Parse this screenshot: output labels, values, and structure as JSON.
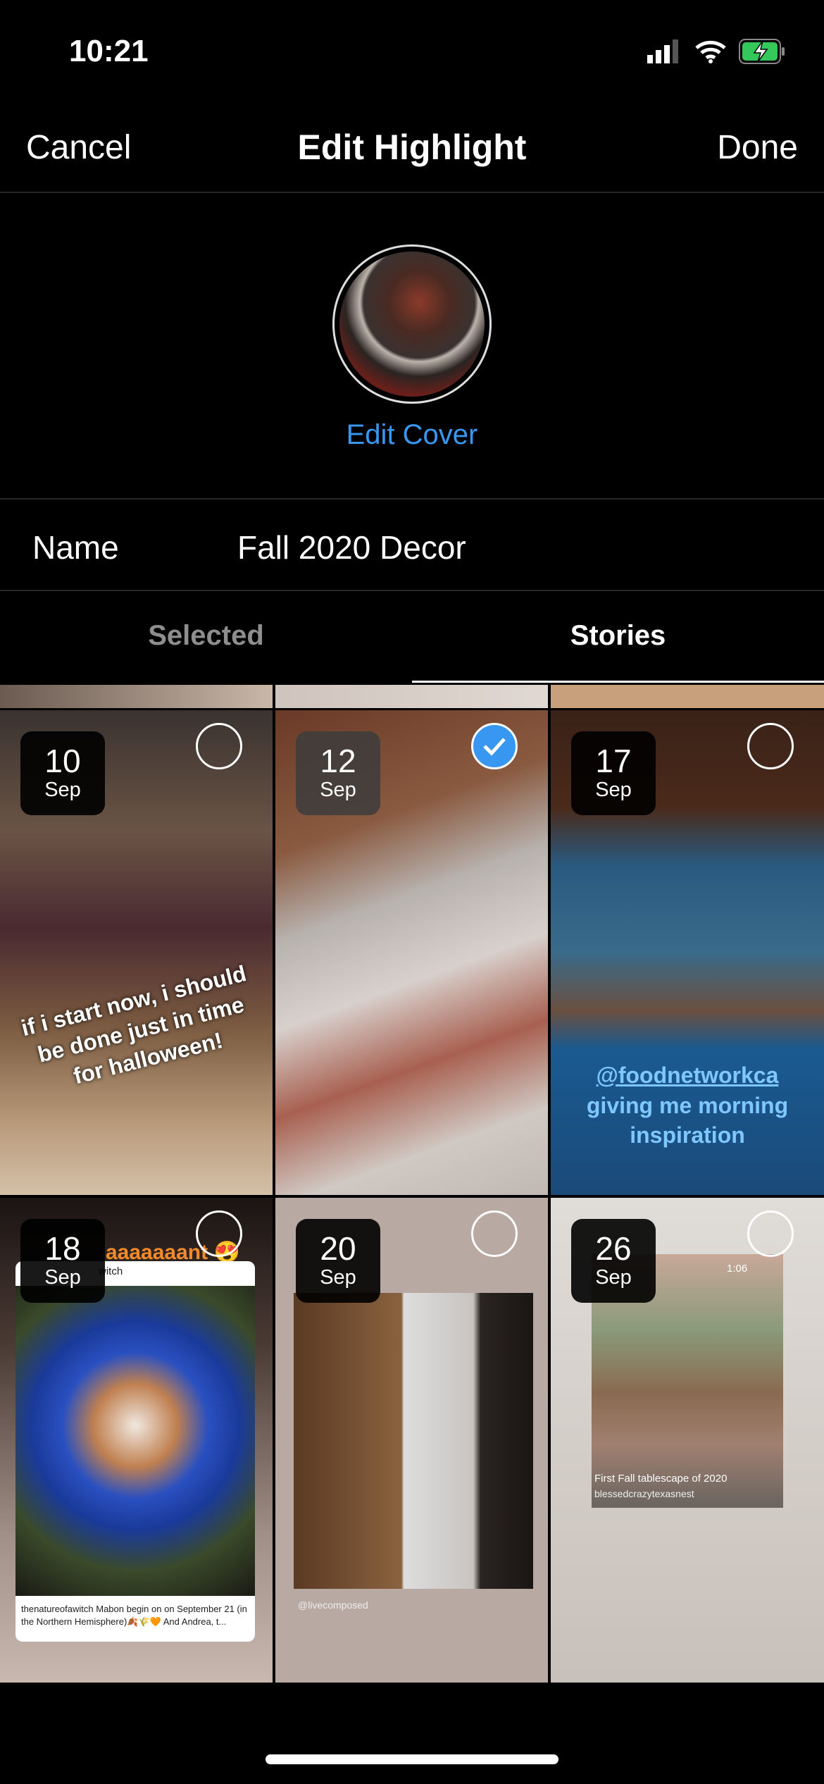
{
  "status_bar": {
    "time": "10:21",
    "icons": [
      "cellular-signal-icon",
      "wifi-icon",
      "battery-charging-icon"
    ],
    "battery_color": "#34c759"
  },
  "nav": {
    "cancel": "Cancel",
    "title": "Edit Highlight",
    "done": "Done"
  },
  "cover": {
    "edit_label": "Edit Cover",
    "link_color": "#3897f0"
  },
  "name_field": {
    "label": "Name",
    "value": "Fall 2020 Decor"
  },
  "tabs": [
    {
      "label": "Selected",
      "active": false
    },
    {
      "label": "Stories",
      "active": true
    }
  ],
  "stories": [
    {
      "day": "10",
      "month": "Sep",
      "selected": false,
      "caption": "if i start now, i should be done just in time for halloween!"
    },
    {
      "day": "12",
      "month": "Sep",
      "selected": true
    },
    {
      "day": "17",
      "month": "Sep",
      "selected": false,
      "caption_mention": "@foodnetworkca",
      "caption": "giving me morning inspiration"
    },
    {
      "day": "18",
      "month": "Sep",
      "selected": false,
      "caption": "aaaaaaant 😍",
      "post_user_fragment": "witch",
      "post_text": "thenatureofawitch Mabon begin on on September 21 (in the Northern Hemisphere)🍂🌾🧡 And Andrea, t..."
    },
    {
      "day": "20",
      "month": "Sep",
      "selected": false,
      "credit": "@livecomposed"
    },
    {
      "day": "26",
      "month": "Sep",
      "selected": false,
      "duration": "1:06",
      "caption": "First Fall tablescape of 2020",
      "credit": "blessedcrazytexasnest"
    }
  ]
}
